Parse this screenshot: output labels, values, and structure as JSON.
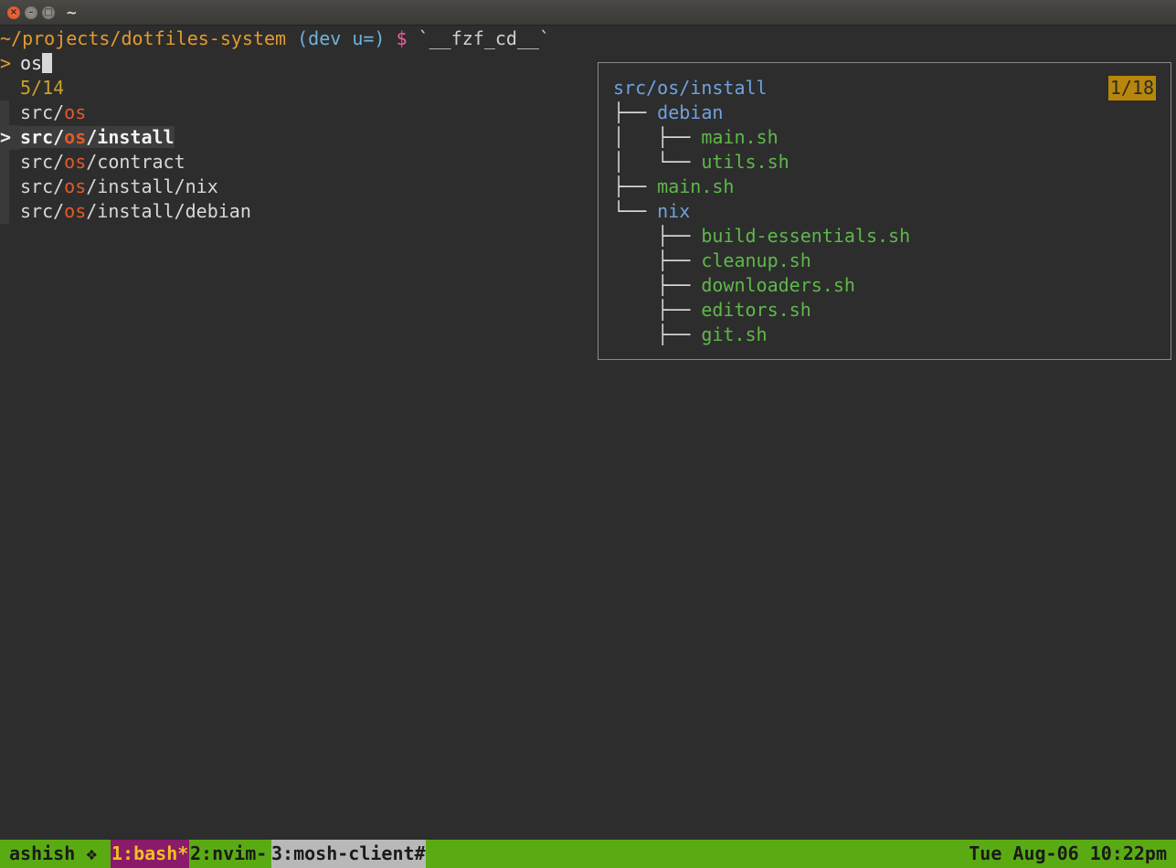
{
  "window": {
    "title": "~",
    "close_glyph": "×",
    "minimize_glyph": "–",
    "maximize_glyph": "□"
  },
  "prompt": {
    "path": "~/projects/dotfiles-system",
    "git_status": "(dev u=)",
    "symbol": "$",
    "command": "`__fzf_cd__`"
  },
  "fzf": {
    "prompt_marker": ">",
    "query": "os",
    "count": "5/14",
    "pointer": ">",
    "selected_index": 1,
    "items": [
      {
        "before": "src/",
        "match": "os",
        "after": ""
      },
      {
        "before": "src/",
        "match": "os",
        "after": "/install"
      },
      {
        "before": "src/",
        "match": "os",
        "after": "/contract"
      },
      {
        "before": "src/",
        "match": "os",
        "after": "/install/nix"
      },
      {
        "before": "src/",
        "match": "os",
        "after": "/install/debian"
      }
    ]
  },
  "preview": {
    "root": "src/os/install",
    "counter": "1/18",
    "lines": [
      {
        "prefix": "├── ",
        "name": "debian",
        "kind": "dir"
      },
      {
        "prefix": "│   ├── ",
        "name": "main.sh",
        "kind": "file"
      },
      {
        "prefix": "│   └── ",
        "name": "utils.sh",
        "kind": "file"
      },
      {
        "prefix": "├── ",
        "name": "main.sh",
        "kind": "file"
      },
      {
        "prefix": "└── ",
        "name": "nix",
        "kind": "dir"
      },
      {
        "prefix": "    ├── ",
        "name": "build-essentials.sh",
        "kind": "file"
      },
      {
        "prefix": "    ├── ",
        "name": "cleanup.sh",
        "kind": "file"
      },
      {
        "prefix": "    ├── ",
        "name": "downloaders.sh",
        "kind": "file"
      },
      {
        "prefix": "    ├── ",
        "name": "editors.sh",
        "kind": "file"
      },
      {
        "prefix": "    ├── ",
        "name": "git.sh",
        "kind": "file"
      }
    ]
  },
  "tmux": {
    "session": "ashish ❖",
    "windows": [
      {
        "label": "1:bash*"
      },
      {
        "label": "2:nvim-"
      },
      {
        "label": "3:mosh-client#"
      }
    ],
    "clock": "Tue Aug-06 10:22pm"
  },
  "colors": {
    "background": "#2d2d2d",
    "path": "#e39b2e",
    "git": "#6fb3d9",
    "prompt_symbol": "#ec5f9e",
    "match": "#e5582a",
    "dir": "#6fa3df",
    "file": "#5fb84a",
    "statusbar": "#5aab13",
    "active_window": "#8a1a6a"
  }
}
